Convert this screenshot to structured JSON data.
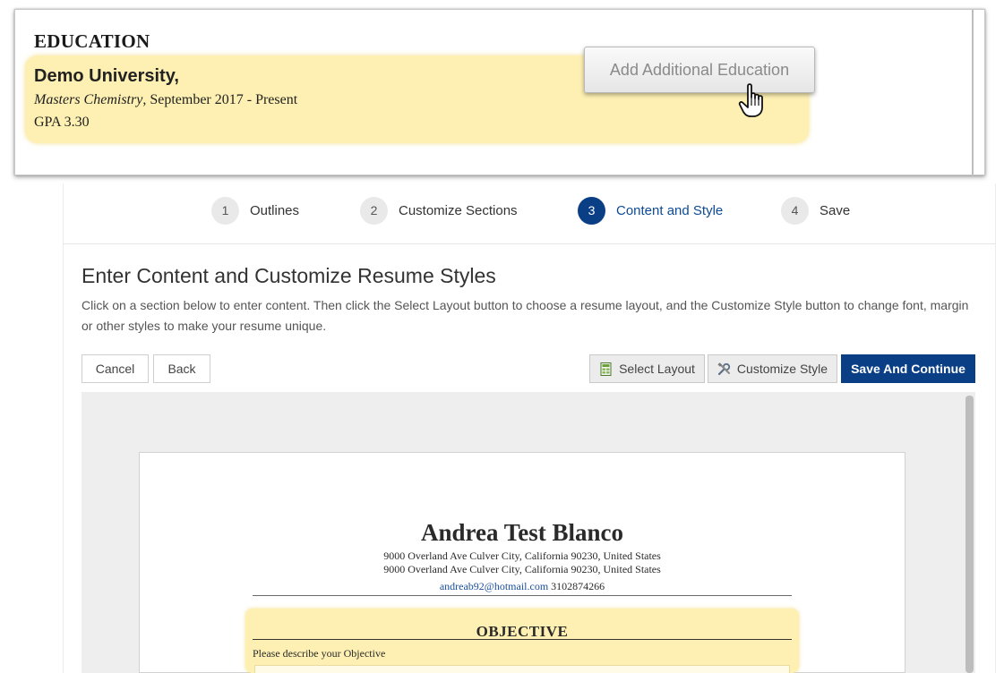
{
  "callout": {
    "section_heading": "EDUCATION",
    "school": "Demo University,",
    "degree": "Masters Chemistry",
    "dates": ", September 2017 - Present",
    "gpa": "GPA 3.30",
    "add_button_label": "Add Additional Education",
    "cursor_icon": "hand-pointer-icon"
  },
  "steps": [
    {
      "num": "1",
      "label": "Outlines",
      "active": false
    },
    {
      "num": "2",
      "label": "Customize Sections",
      "active": false
    },
    {
      "num": "3",
      "label": "Content and Style",
      "active": true
    },
    {
      "num": "4",
      "label": "Save",
      "active": false
    }
  ],
  "page": {
    "title": "Enter Content and Customize Resume Styles",
    "description": "Click on a section below to enter content. Then click the Select Layout button to choose a resume layout, and the Customize Style button to change font, margin or other styles to make your resume unique."
  },
  "toolbar": {
    "cancel_label": "Cancel",
    "back_label": "Back",
    "select_layout_label": "Select Layout",
    "select_layout_icon": "layout-icon",
    "customize_style_label": "Customize Style",
    "customize_style_icon": "tools-icon",
    "save_continue_label": "Save And Continue"
  },
  "resume": {
    "name": "Andrea Test Blanco",
    "address_1": "9000 Overland Ave Culver City, California 90230, United States",
    "address_2": "9000 Overland Ave Culver City, California 90230, United States",
    "email": "andreab92@hotmail.com",
    "phone": " 3102874266",
    "objective_heading": "OBJECTIVE",
    "objective_placeholder": "Please describe your Objective"
  },
  "colors": {
    "primary": "#0a3f86",
    "highlight": "#fdf0b2",
    "link": "#1a4f9c"
  }
}
